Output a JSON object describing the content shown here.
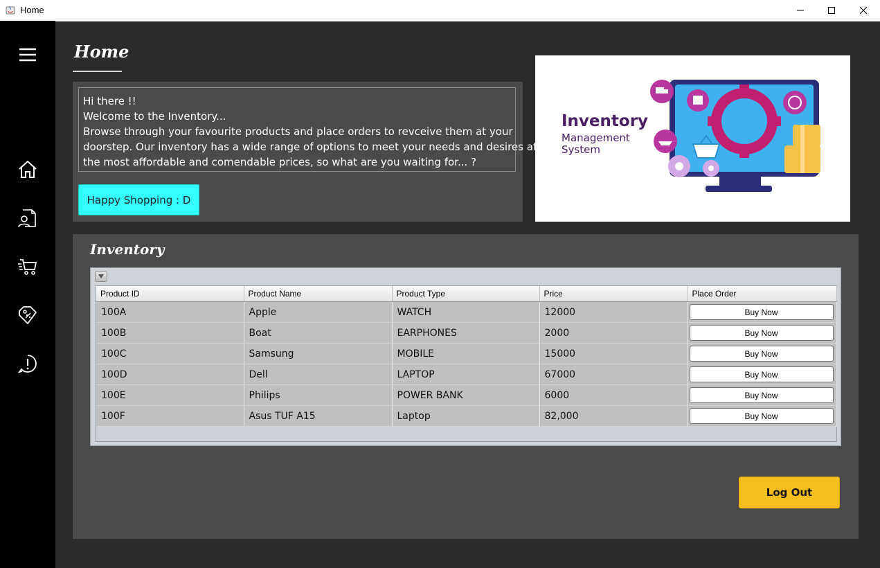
{
  "window": {
    "title": "Home"
  },
  "sidebar": {
    "icons": [
      "menu-icon",
      "home-icon",
      "user-document-icon",
      "fast-cart-icon",
      "price-tag-icon",
      "alert-icon"
    ]
  },
  "home": {
    "heading": "Home"
  },
  "welcome": {
    "lines": [
      "Hi there !!",
      "Welcome to the Inventory...",
      "Browse through your favourite products and place orders to revceive them at your",
      "doorstep. Our inventory has a wide range of options to meet your needs and desires at",
      "the most affordable and comendable prices, so what are you waiting for... ?"
    ],
    "button_label": "Happy Shopping : D"
  },
  "illustration": {
    "title": "Inventory",
    "subtitle_line1": "Management",
    "subtitle_line2": "System"
  },
  "inventory": {
    "heading": "Inventory",
    "columns": [
      "Product ID",
      "Product Name",
      "Product Type",
      "Price",
      "Place Order"
    ],
    "rows": [
      {
        "id": "100A",
        "name": "Apple",
        "type": "WATCH",
        "price": "12000",
        "action": "Buy Now"
      },
      {
        "id": "100B",
        "name": "Boat",
        "type": "EARPHONES",
        "price": "2000",
        "action": "Buy Now"
      },
      {
        "id": "100C",
        "name": "Samsung",
        "type": "MOBILE",
        "price": "15000",
        "action": "Buy Now"
      },
      {
        "id": "100D",
        "name": "Dell",
        "type": "LAPTOP",
        "price": "67000",
        "action": "Buy Now"
      },
      {
        "id": "100E",
        "name": "Philips",
        "type": "POWER BANK",
        "price": "6000",
        "action": "Buy Now"
      },
      {
        "id": "100F",
        "name": "Asus TUF A15",
        "type": "Laptop",
        "price": "82,000",
        "action": "Buy Now"
      }
    ]
  },
  "logout": {
    "label": "Log Out"
  },
  "colors": {
    "accent_cyan": "#33ffff",
    "accent_yellow": "#f6bf1e",
    "panel": "#4a4a4a",
    "background": "#2b2b2b",
    "sidebar": "#000000"
  }
}
